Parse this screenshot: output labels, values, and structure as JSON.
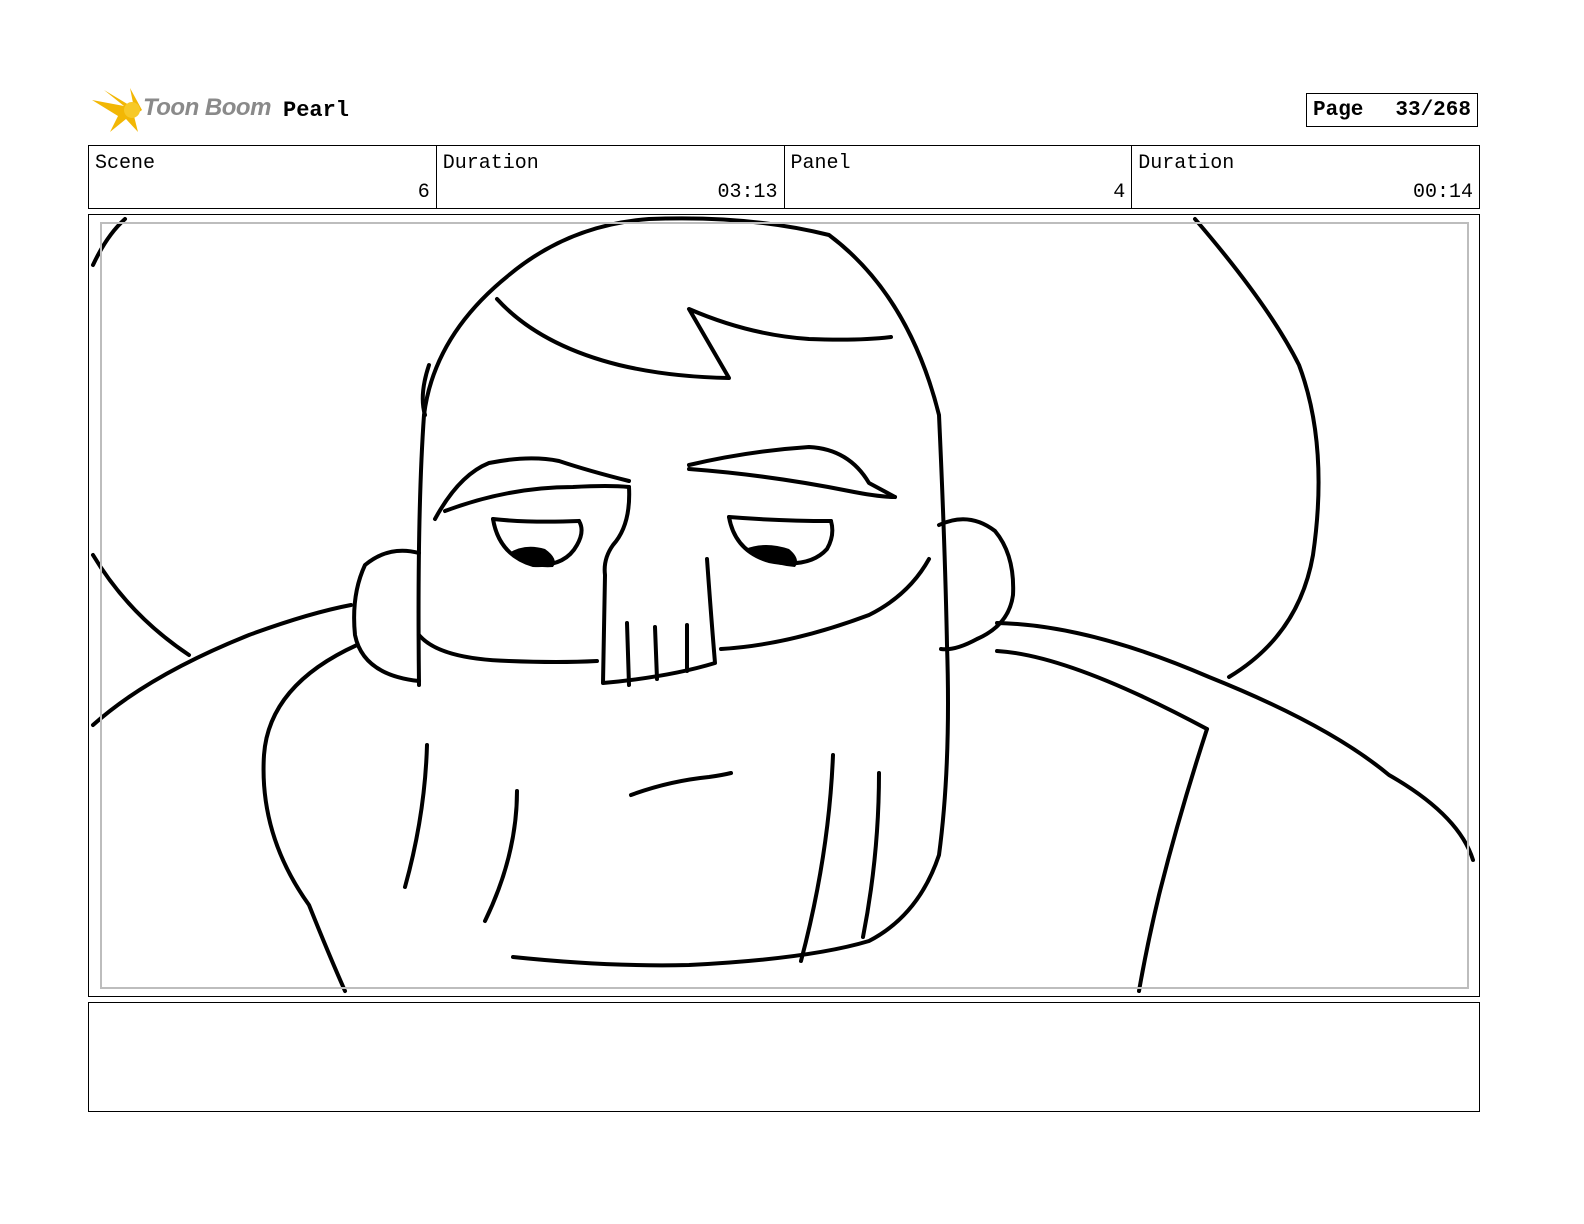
{
  "header": {
    "logo_text": "Toon Boom",
    "project": "Pearl",
    "page_label": "Page",
    "page_value": "33/268"
  },
  "info": {
    "scene_label": "Scene",
    "scene_value": "6",
    "scene_duration_label": "Duration",
    "scene_duration_value": "03:13",
    "panel_label": "Panel",
    "panel_value": "4",
    "panel_duration_label": "Duration",
    "panel_duration_value": "00:14"
  },
  "notes": {
    "text": ""
  },
  "colors": {
    "logo_accent": "#f2b705",
    "logo_text": "#8a8a8a",
    "safe_frame": "#bdbdbd"
  }
}
